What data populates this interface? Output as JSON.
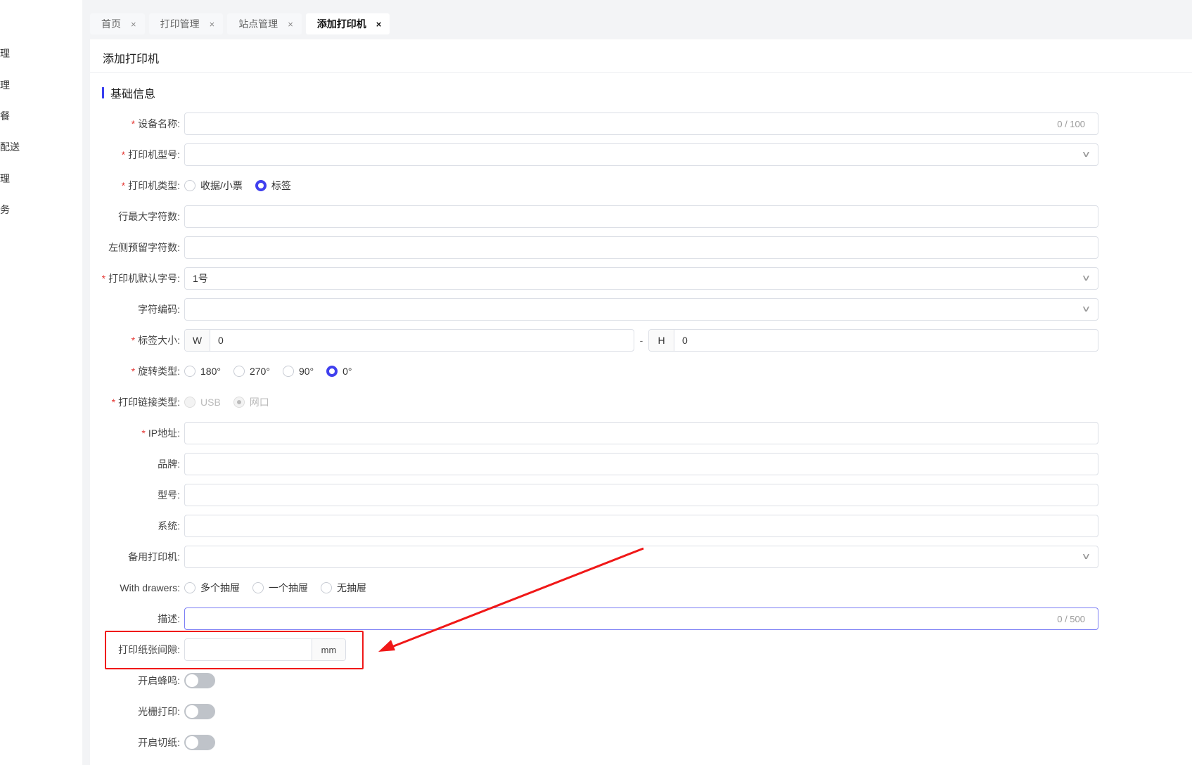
{
  "sidebar": {
    "items": [
      "理",
      "理",
      "餐",
      "配送",
      "理",
      "务"
    ]
  },
  "tabs": [
    {
      "label": "首页",
      "active": false
    },
    {
      "label": "打印管理",
      "active": false
    },
    {
      "label": "站点管理",
      "active": false
    },
    {
      "label": "添加打印机",
      "active": true
    }
  ],
  "tab_close_glyph": "×",
  "page": {
    "title": "添加打印机",
    "section": "基础信息"
  },
  "form": {
    "device_name": {
      "label": "设备名称:",
      "required": true,
      "value": "",
      "counter": "0 / 100"
    },
    "printer_model": {
      "label": "打印机型号:",
      "required": true,
      "value": ""
    },
    "printer_type": {
      "label": "打印机类型:",
      "required": true,
      "options": [
        "收据/小票",
        "标签"
      ],
      "selected": "标签"
    },
    "max_chars": {
      "label": "行最大字符数:",
      "value": ""
    },
    "left_reserved": {
      "label": "左侧预留字符数:",
      "value": ""
    },
    "default_font": {
      "label": "打印机默认字号:",
      "required": true,
      "value": "1号"
    },
    "encoding": {
      "label": "字符编码:",
      "value": ""
    },
    "label_size": {
      "label": "标签大小:",
      "required": true,
      "w_prefix": "W",
      "w_value": "0",
      "sep": "-",
      "h_prefix": "H",
      "h_value": "0"
    },
    "rotation": {
      "label": "旋转类型:",
      "required": true,
      "options": [
        "180°",
        "270°",
        "90°",
        "0°"
      ],
      "selected": "0°"
    },
    "link_type": {
      "label": "打印链接类型:",
      "required": true,
      "options": [
        "USB",
        "网口"
      ],
      "selected": "网口",
      "disabled": true
    },
    "ip": {
      "label": "IP地址:",
      "required": true,
      "value": ""
    },
    "brand": {
      "label": "品牌:",
      "value": ""
    },
    "model": {
      "label": "型号:",
      "value": ""
    },
    "system": {
      "label": "系统:",
      "value": ""
    },
    "backup_printer": {
      "label": "备用打印机:",
      "value": ""
    },
    "drawers": {
      "label": "With drawers:",
      "options": [
        "多个抽屉",
        "一个抽屉",
        "无抽屉"
      ],
      "selected": ""
    },
    "description": {
      "label": "描述:",
      "value": "",
      "counter": "0 / 500"
    },
    "paper_gap": {
      "label": "打印纸张间隙:",
      "value": "",
      "unit": "mm"
    },
    "beep": {
      "label": "开启蜂鸣:",
      "on": false
    },
    "raster": {
      "label": "光栅打印:",
      "on": false
    },
    "cutter": {
      "label": "开启切纸:",
      "on": false
    }
  },
  "icons": {
    "select_arrow": "chevron-down-icon",
    "required_mark": "*"
  },
  "colors": {
    "accent": "#4040ee",
    "highlight": "#f01818",
    "required": "#e53935"
  }
}
